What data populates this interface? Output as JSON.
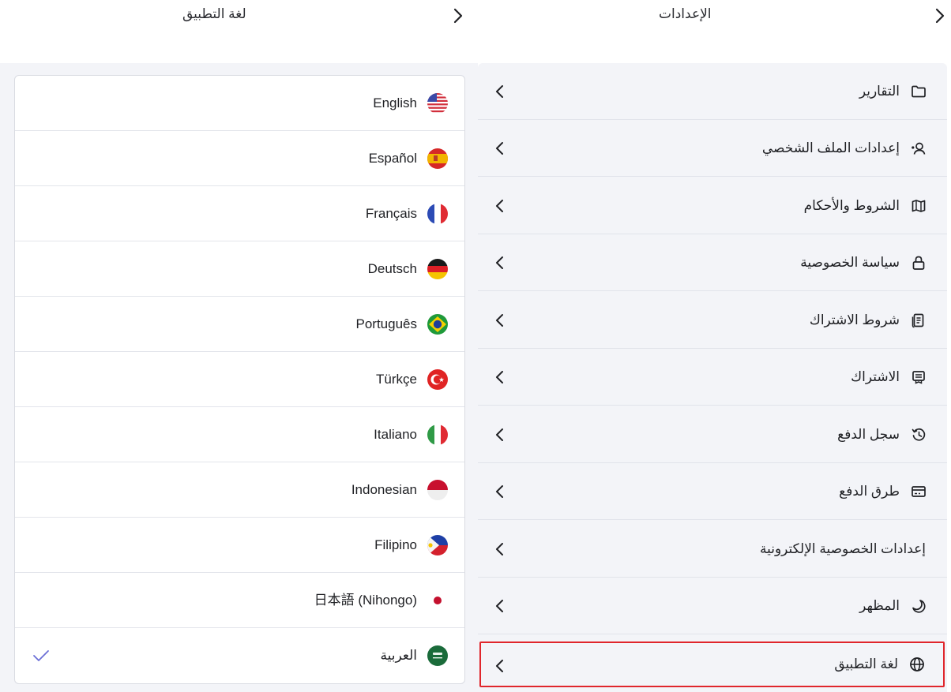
{
  "header": {
    "left_title": "لغة التطبيق",
    "right_title": "الإعدادات"
  },
  "settings": {
    "items": [
      {
        "label": "التقارير",
        "icon": "folder-icon"
      },
      {
        "label": "إعدادات الملف الشخصي",
        "icon": "user-settings-icon"
      },
      {
        "label": "الشروط والأحكام",
        "icon": "map-icon"
      },
      {
        "label": "سياسة الخصوصية",
        "icon": "lock-icon"
      },
      {
        "label": "شروط الاشتراك",
        "icon": "document-icon"
      },
      {
        "label": "الاشتراك",
        "icon": "receipt-icon"
      },
      {
        "label": "سجل الدفع",
        "icon": "history-icon"
      },
      {
        "label": "طرق الدفع",
        "icon": "credit-card-icon"
      },
      {
        "label": "إعدادات الخصوصية الإلكترونية",
        "icon": ""
      },
      {
        "label": "المظهر",
        "icon": "moon-icon"
      },
      {
        "label": "لغة التطبيق",
        "icon": "globe-icon",
        "active": true
      }
    ]
  },
  "languages": {
    "items": [
      {
        "label": "English",
        "flag": "us-flag-icon"
      },
      {
        "label": "Español",
        "flag": "spain-flag-icon"
      },
      {
        "label": "Français",
        "flag": "france-flag-icon"
      },
      {
        "label": "Deutsch",
        "flag": "germany-flag-icon"
      },
      {
        "label": "Português",
        "flag": "brazil-flag-icon"
      },
      {
        "label": "Türkçe",
        "flag": "turkey-flag-icon"
      },
      {
        "label": "Italiano",
        "flag": "italy-flag-icon"
      },
      {
        "label": "Indonesian",
        "flag": "indonesia-flag-icon"
      },
      {
        "label": "Filipino",
        "flag": "philippines-flag-icon"
      },
      {
        "label": "日本語 (Nihongo)",
        "flag": "japan-flag-icon"
      },
      {
        "label": "العربية",
        "flag": "saudi-flag-icon",
        "selected": true
      }
    ],
    "check_icon": "checkmark-icon"
  },
  "colors": {
    "highlight_border": "#e0262c",
    "check": "#6b6fd6",
    "panel_bg": "#f3f4f8"
  }
}
